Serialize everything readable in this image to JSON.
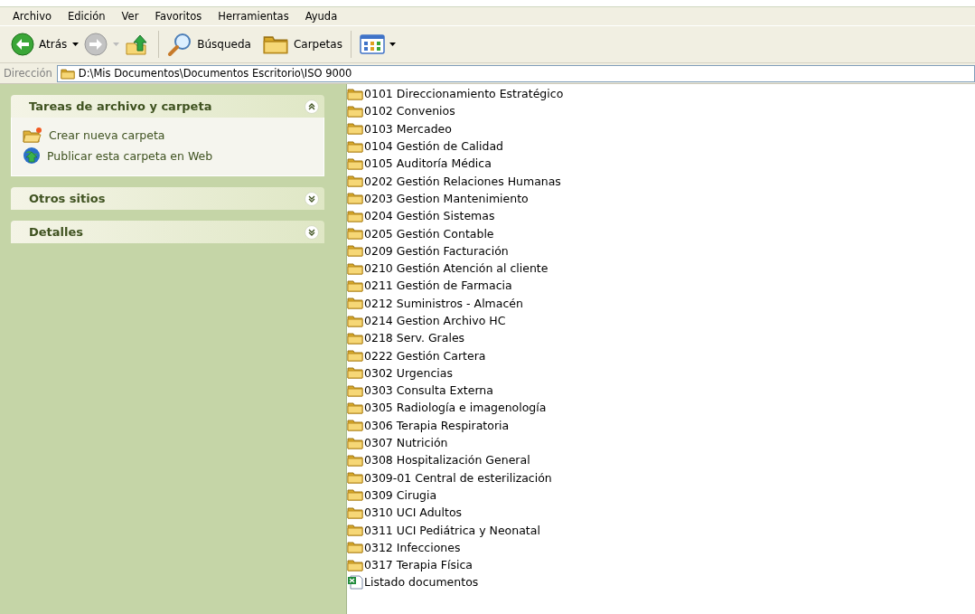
{
  "menu": [
    "Archivo",
    "Edición",
    "Ver",
    "Favoritos",
    "Herramientas",
    "Ayuda"
  ],
  "toolbar": {
    "back": "Atrás",
    "search": "Búsqueda",
    "folders": "Carpetas"
  },
  "address": {
    "label": "Dirección",
    "value": "D:\\Mis Documentos\\Documentos Escritorio\\ISO 9000"
  },
  "panels": [
    {
      "title": "Tareas de archivo y carpeta",
      "expanded": true,
      "items": [
        {
          "kind": "new-folder",
          "label": "Crear nueva carpeta"
        },
        {
          "kind": "publish",
          "label": "Publicar esta carpeta en Web"
        }
      ]
    },
    {
      "title": "Otros sitios",
      "expanded": false
    },
    {
      "title": "Detalles",
      "expanded": false
    }
  ],
  "files": [
    {
      "kind": "folder",
      "name": "0101 Direccionamiento Estratégico"
    },
    {
      "kind": "folder",
      "name": "0102 Convenios"
    },
    {
      "kind": "folder",
      "name": "0103 Mercadeo"
    },
    {
      "kind": "folder",
      "name": "0104 Gestión de Calidad"
    },
    {
      "kind": "folder",
      "name": "0105 Auditoría Médica"
    },
    {
      "kind": "folder",
      "name": "0202 Gestión Relaciones Humanas"
    },
    {
      "kind": "folder",
      "name": "0203 Gestion Mantenimiento"
    },
    {
      "kind": "folder",
      "name": "0204 Gestión Sistemas"
    },
    {
      "kind": "folder",
      "name": "0205 Gestión Contable"
    },
    {
      "kind": "folder",
      "name": "0209 Gestión Facturación"
    },
    {
      "kind": "folder",
      "name": "0210 Gestión Atención al cliente"
    },
    {
      "kind": "folder",
      "name": "0211 Gestión de Farmacia"
    },
    {
      "kind": "folder",
      "name": "0212 Suministros - Almacén"
    },
    {
      "kind": "folder",
      "name": "0214 Gestion Archivo HC"
    },
    {
      "kind": "folder",
      "name": "0218 Serv. Grales"
    },
    {
      "kind": "folder",
      "name": "0222 Gestión Cartera"
    },
    {
      "kind": "folder",
      "name": "0302 Urgencias"
    },
    {
      "kind": "folder",
      "name": "0303 Consulta Externa"
    },
    {
      "kind": "folder",
      "name": "0305 Radiología e imagenología"
    },
    {
      "kind": "folder",
      "name": "0306 Terapia Respiratoria"
    },
    {
      "kind": "folder",
      "name": "0307 Nutrición"
    },
    {
      "kind": "folder",
      "name": "0308 Hospitalización General"
    },
    {
      "kind": "folder",
      "name": "0309-01 Central de esterilización"
    },
    {
      "kind": "folder",
      "name": "0309 Cirugia"
    },
    {
      "kind": "folder",
      "name": "0310 UCI Adultos"
    },
    {
      "kind": "folder",
      "name": "0311 UCI Pediátrica y Neonatal"
    },
    {
      "kind": "folder",
      "name": "0312 Infecciones"
    },
    {
      "kind": "folder",
      "name": "0317 Terapia Física"
    },
    {
      "kind": "spreadsheet",
      "name": "Listado documentos"
    }
  ]
}
